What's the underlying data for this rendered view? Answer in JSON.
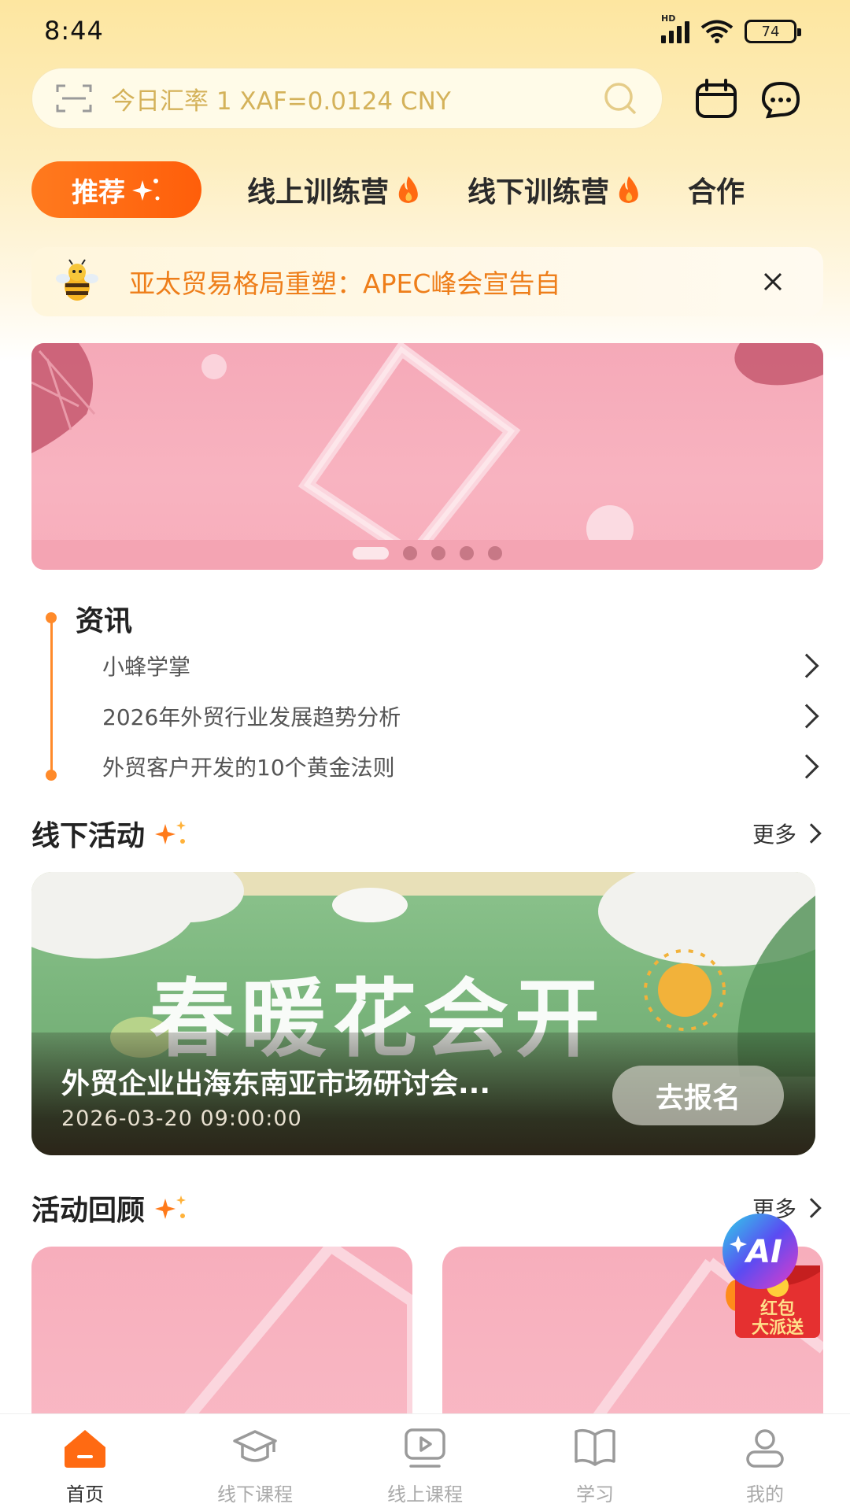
{
  "status_bar": {
    "time": "8:44",
    "battery": "74"
  },
  "search": {
    "placeholder": "今日汇率 1 XAF=0.0124 CNY"
  },
  "tabs": [
    {
      "label": "推荐"
    },
    {
      "label": "线上训练营"
    },
    {
      "label": "线下训练营"
    },
    {
      "label": "合作"
    }
  ],
  "notice": {
    "text": "亚太贸易格局重塑：APEC峰会宣告自"
  },
  "banner": {
    "page_count": 5,
    "active_index": 0
  },
  "news": {
    "title": "资讯",
    "items": [
      {
        "label": "小蜂学掌"
      },
      {
        "label": "2026年外贸行业发展趋势分析"
      },
      {
        "label": "外贸客户开发的10个黄金法则"
      }
    ]
  },
  "offline_activity": {
    "title": "线下活动",
    "more": "更多",
    "card": {
      "image_text": "春暖花会开",
      "title": "外贸企业出海东南亚市场研讨会...",
      "time": "2026-03-20 09:00:00",
      "button": "去报名"
    }
  },
  "review": {
    "title": "活动回顾",
    "more": "更多"
  },
  "floating": {
    "ai_label": "AI",
    "red_packet_line1": "红包",
    "red_packet_line2": "大派送"
  },
  "bottom_nav": [
    {
      "label": "首页",
      "icon": "home-icon",
      "active": true
    },
    {
      "label": "线下课程",
      "icon": "graduation-cap-icon",
      "active": false
    },
    {
      "label": "线上课程",
      "icon": "video-play-icon",
      "active": false
    },
    {
      "label": "学习",
      "icon": "book-icon",
      "active": false
    },
    {
      "label": "我的",
      "icon": "user-icon",
      "active": false
    }
  ],
  "colors": {
    "accent": "#ff6a12",
    "notice_text": "#ee7e1a",
    "search_text": "#d4b25a"
  }
}
